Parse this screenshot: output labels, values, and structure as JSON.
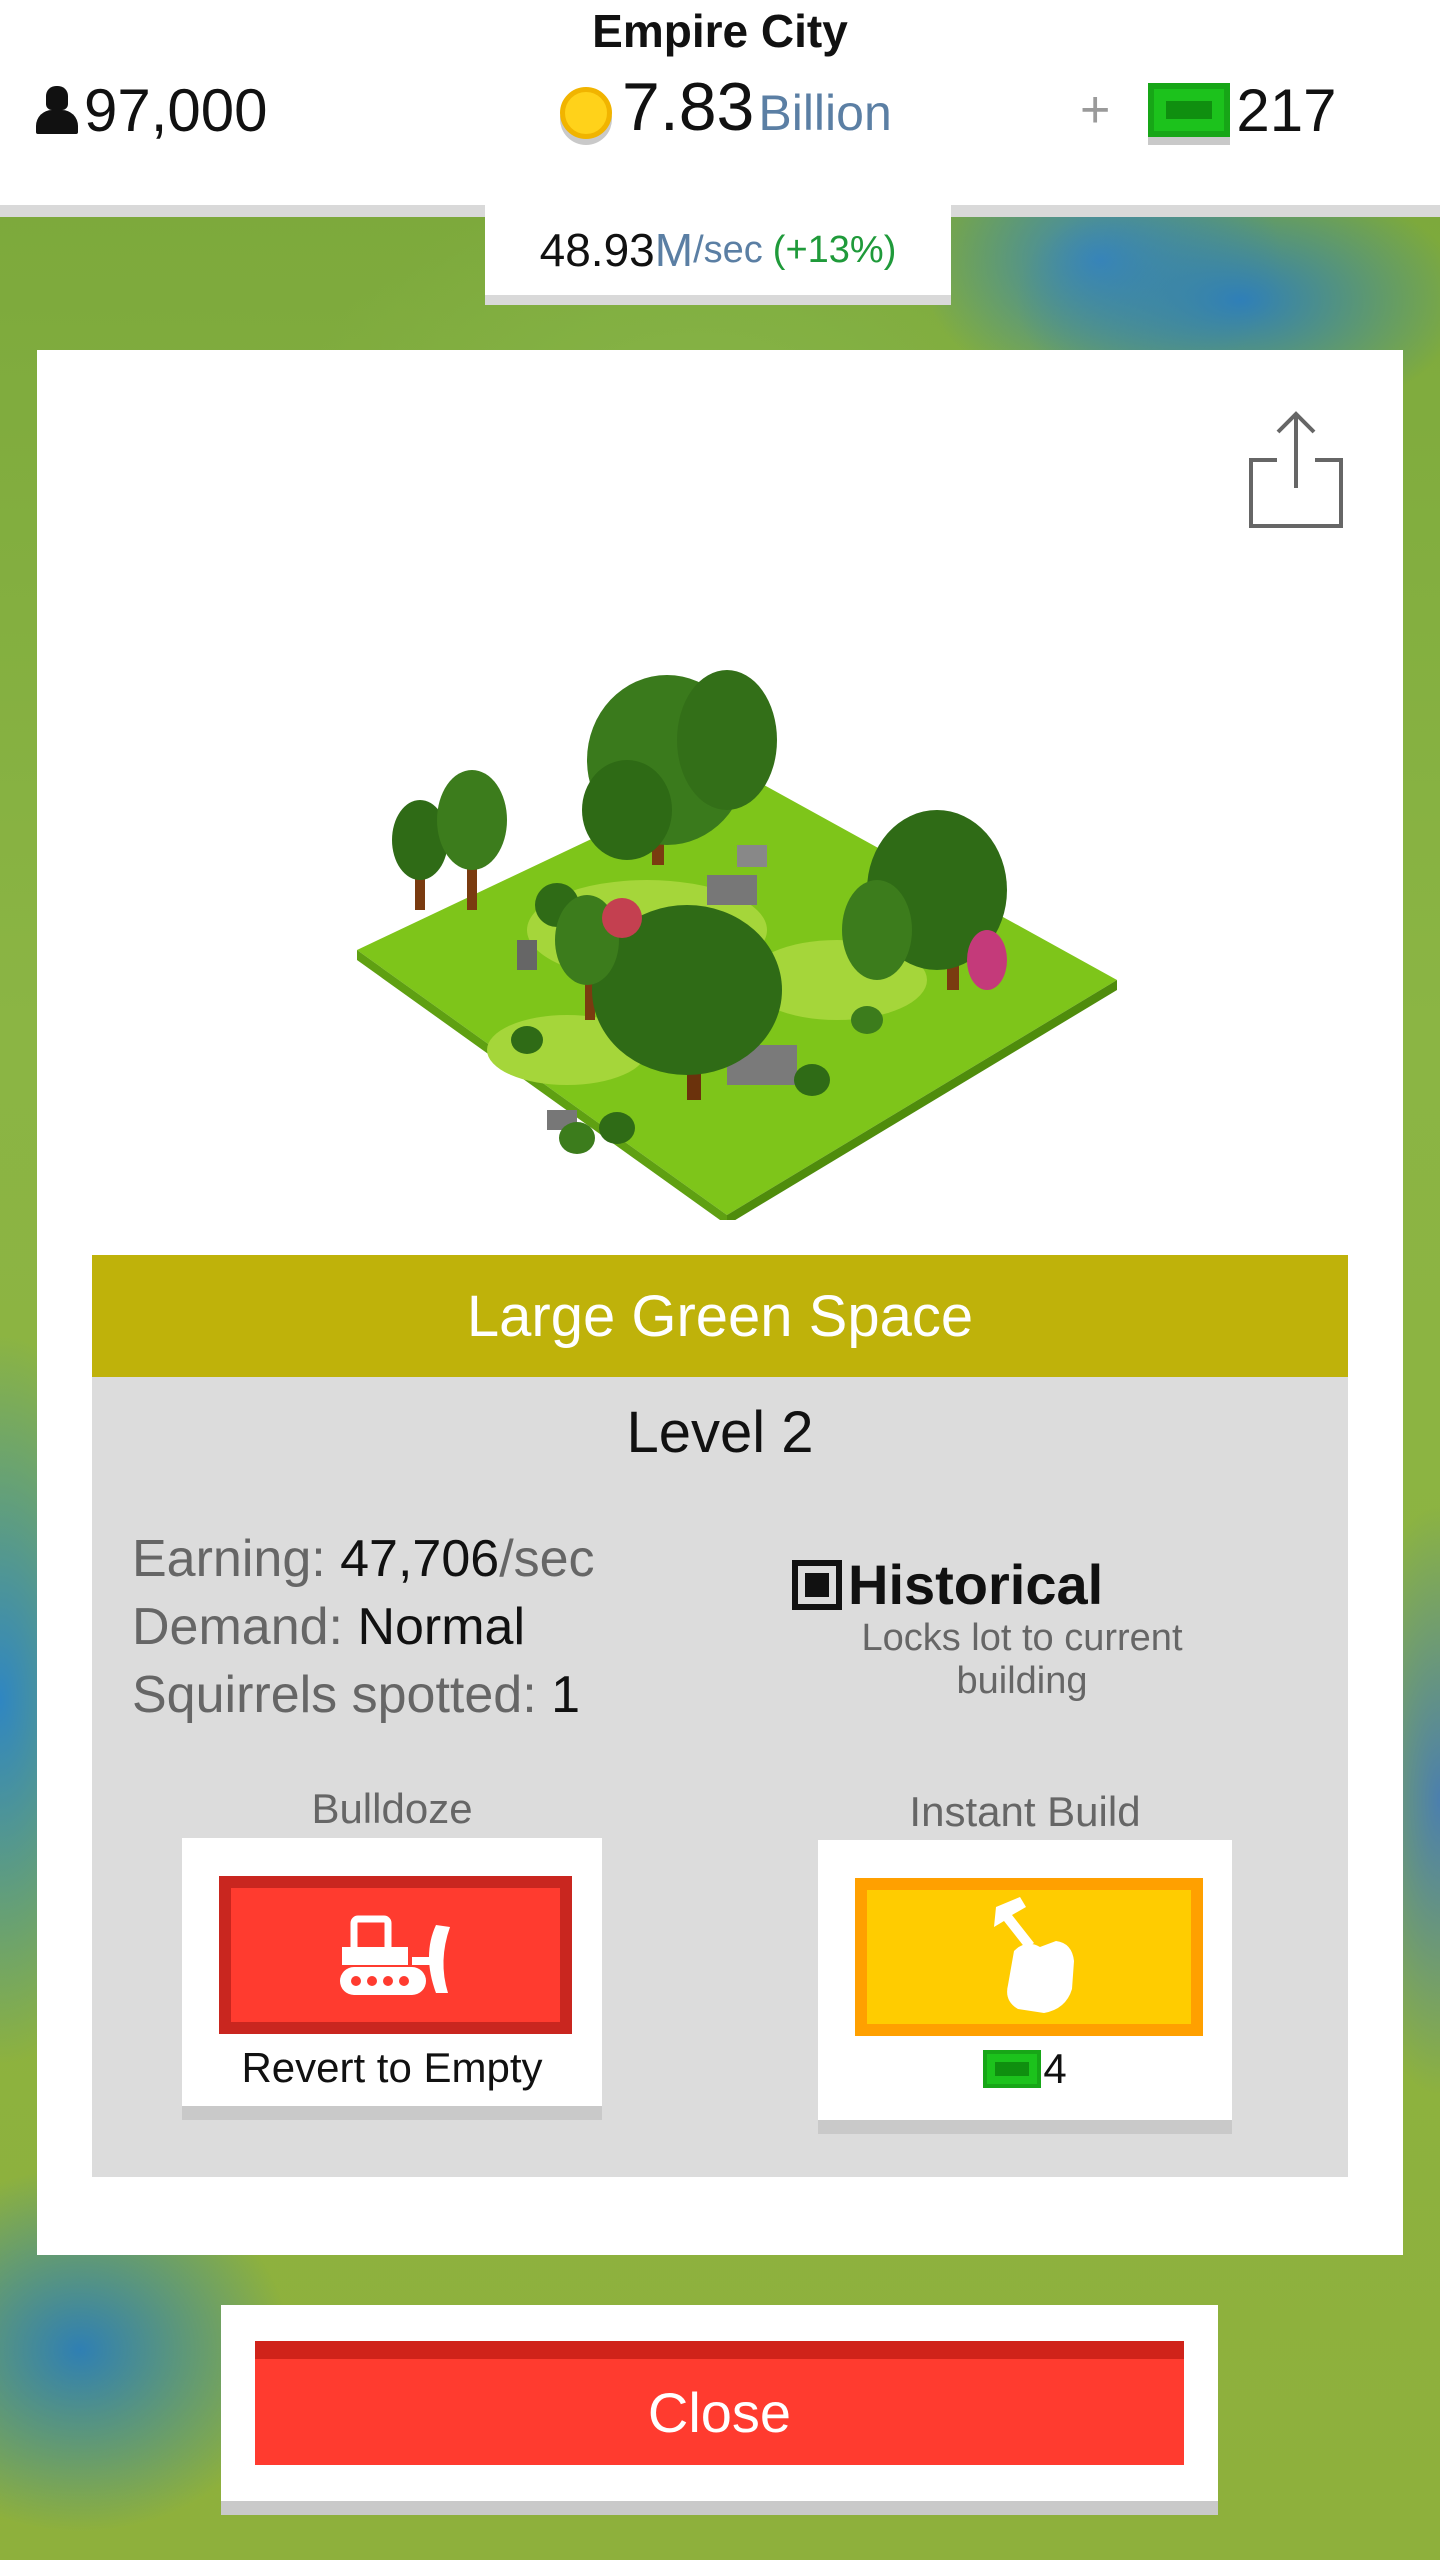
{
  "header": {
    "city_name": "Empire City",
    "population": "97,000",
    "money_value": "7.83",
    "money_unit": "Billion",
    "cash_plus": "+",
    "cash_value": "217",
    "rate_value": "48.93",
    "rate_unit": "M",
    "rate_per": "/sec",
    "rate_bonus": "(+13%)"
  },
  "building": {
    "name": "Large Green Space",
    "level": "Level 2",
    "earning_label": "Earning: ",
    "earning_value": "47,706",
    "earning_unit": "/sec",
    "demand_label": "Demand: ",
    "demand_value": "Normal",
    "squirrels_label": "Squirrels spotted: ",
    "squirrels_value": "1",
    "historical_label": "Historical",
    "historical_checked": true,
    "historical_sub": "Locks lot to current building"
  },
  "actions": {
    "bulldoze_label": "Bulldoze",
    "bulldoze_button_text": "Revert to Empty",
    "instant_build_label": "Instant Build",
    "instant_build_cost": "4"
  },
  "footer": {
    "close_label": "Close"
  },
  "icons": {
    "population": "person-icon",
    "money": "coin-icon",
    "cash": "cash-bill-icon",
    "share": "share-icon",
    "bulldoze": "bulldozer-icon",
    "instant_build": "hammer-hand-icon"
  },
  "colors": {
    "title_bar": "#bfb20a",
    "danger": "#ff3b2f",
    "build": "#ffcc00",
    "cash_green": "#1cc21c",
    "rate_unit": "#5b7fa4",
    "bonus": "#1f9a3a"
  }
}
